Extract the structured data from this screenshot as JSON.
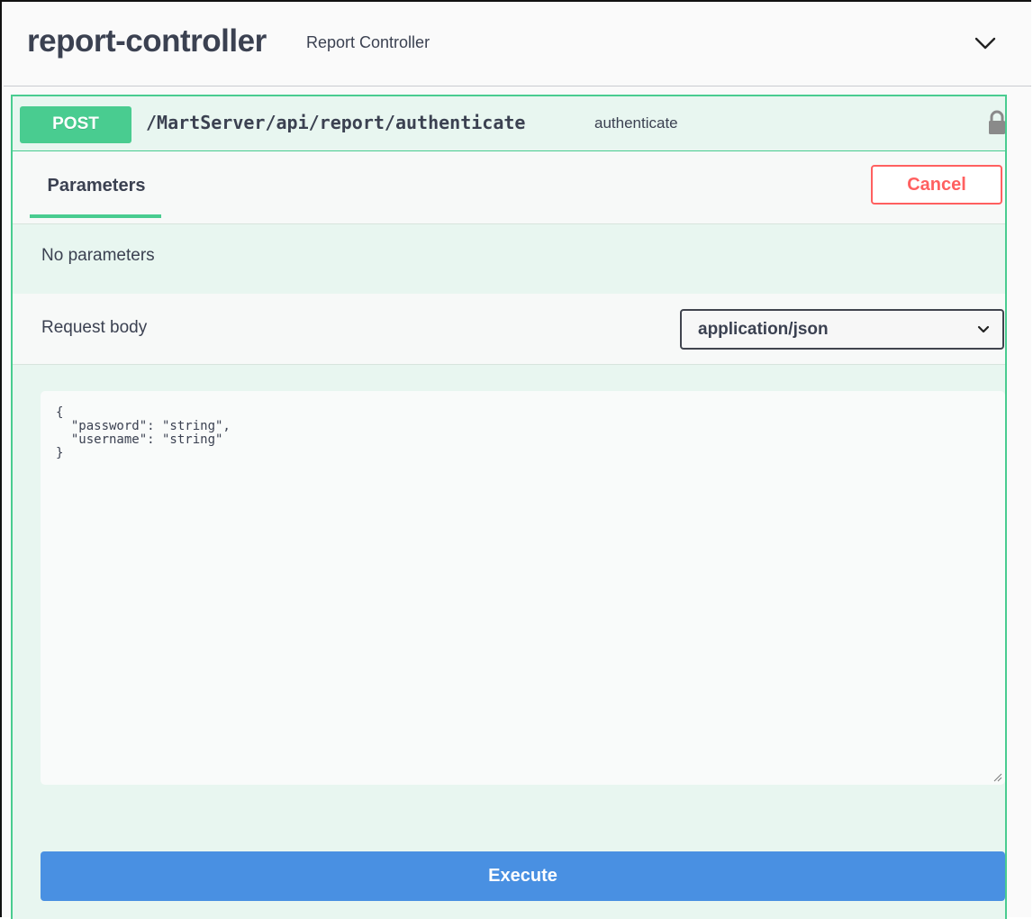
{
  "tag": {
    "name": "report-controller",
    "description": "Report Controller",
    "collapse_icon": "chevron-down-icon"
  },
  "operation": {
    "method": "POST",
    "path": "/MartServer/api/report/authenticate",
    "summary": "authenticate",
    "lock_icon": "lock-icon",
    "colors": {
      "post": "#49cc90",
      "background": "#e8f6f0"
    }
  },
  "parameters": {
    "tab_label": "Parameters",
    "cancel_label": "Cancel",
    "empty_text": "No parameters",
    "cancel_color": "#ff6060"
  },
  "request_body": {
    "label": "Request body",
    "content_type": "application/json",
    "content_type_options": [
      "application/json"
    ],
    "body_text": "{\n  \"password\": \"string\",\n  \"username\": \"string\"\n}"
  },
  "actions": {
    "execute_label": "Execute",
    "execute_color": "#4990e2"
  }
}
